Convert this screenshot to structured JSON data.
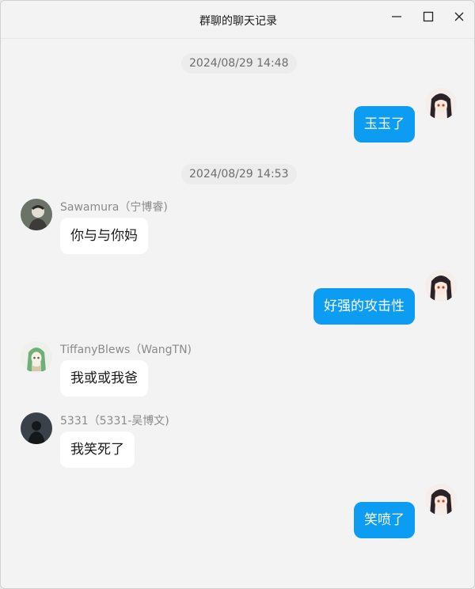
{
  "window": {
    "title": "群聊的聊天记录",
    "controls": {
      "minimize": "minimize",
      "maximize": "maximize",
      "close": "close"
    }
  },
  "messages": {
    "ts1": "2024/08/29 14:48",
    "m1": {
      "text": "玉玉了"
    },
    "ts2": "2024/08/29 14:53",
    "m2": {
      "sender": "Sawamura（宁博睿)",
      "text": "你与与你妈"
    },
    "m3": {
      "text": "好强的攻击性"
    },
    "m4": {
      "sender": "TiffanyBlews（WangTN)",
      "text": "我或或我爸"
    },
    "m5": {
      "sender": "5331（5331-吴博文)",
      "text": "我笑死了"
    },
    "m6": {
      "text": "笑喷了"
    }
  },
  "colors": {
    "outgoing_bubble": "#0c9df2",
    "incoming_bubble": "#ffffff",
    "background": "#f3f3f3"
  }
}
